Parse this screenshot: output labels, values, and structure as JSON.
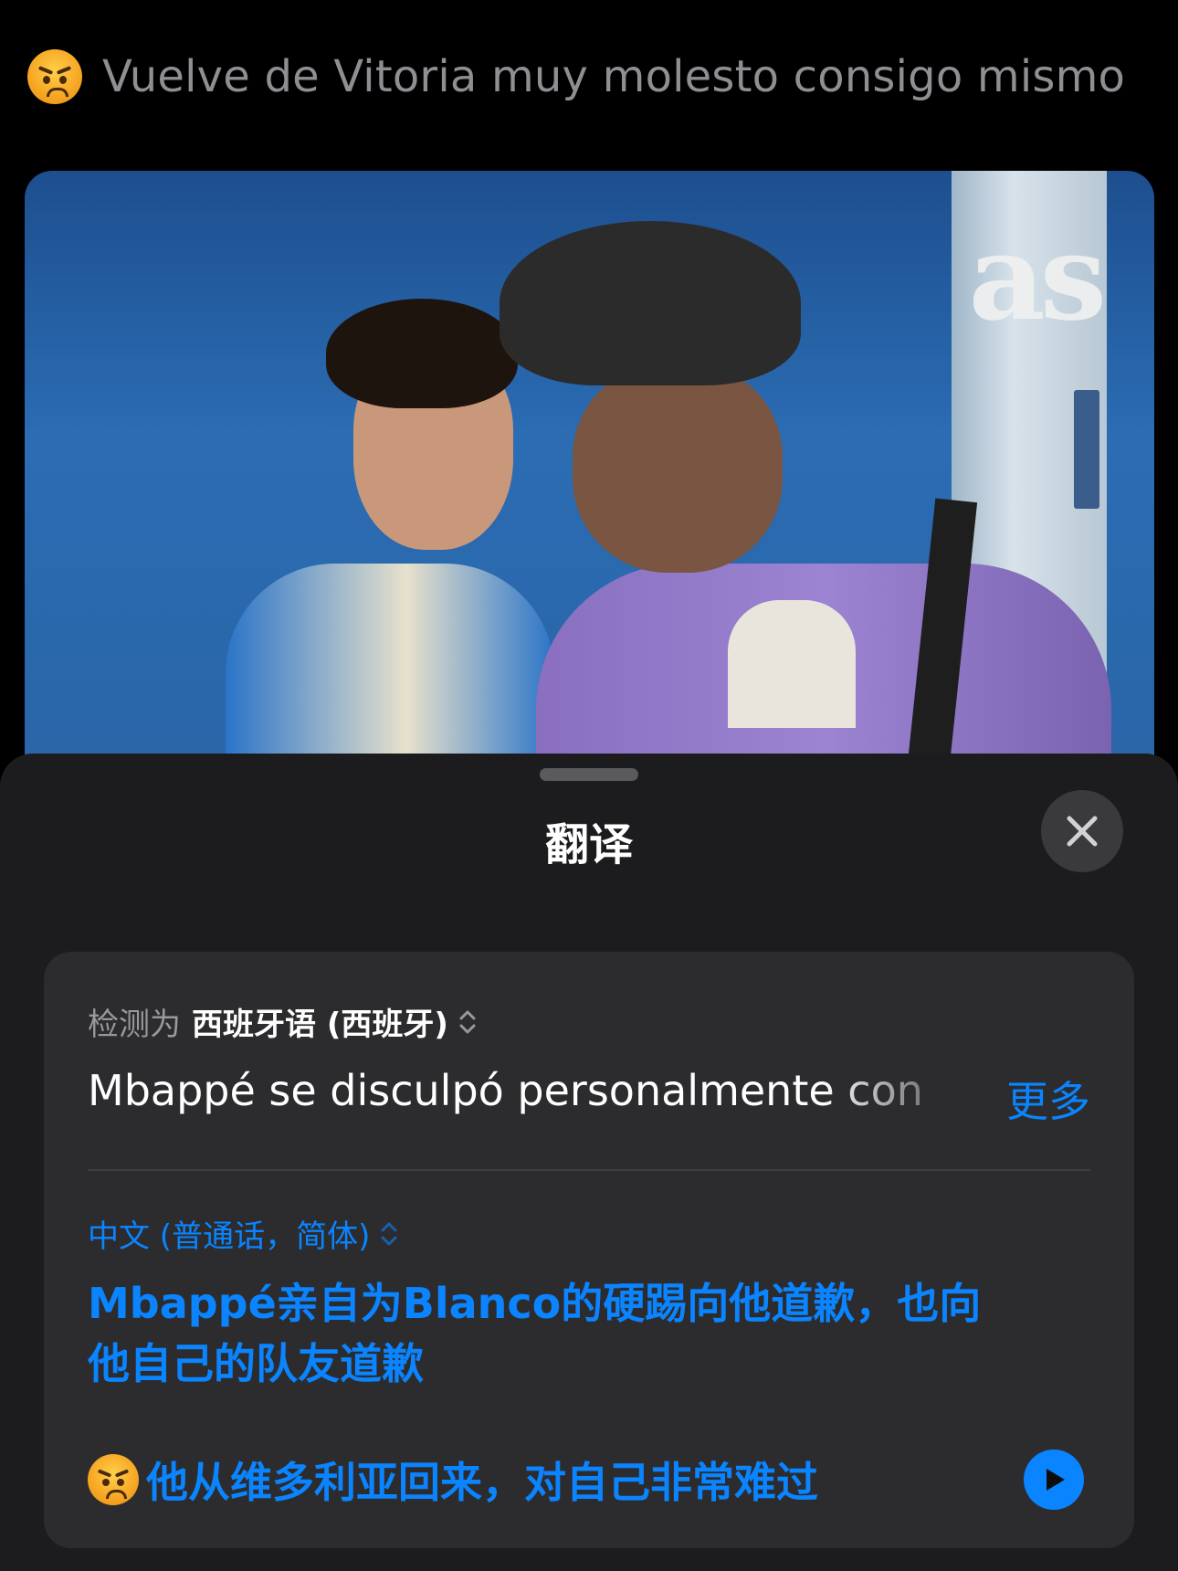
{
  "tweet": {
    "emoji_icon": "angry-face-icon",
    "text": "Vuelve de Vitoria muy molesto consigo mismo"
  },
  "photo": {
    "watermark": "as"
  },
  "sheet": {
    "title": "翻译",
    "close_icon": "close-icon",
    "source": {
      "detected_prefix": "检测为",
      "language": "西班牙语 (西班牙)",
      "text": "Mbappé se disculpó personalmente con",
      "more_label": "更多"
    },
    "target": {
      "language": "中文 (普通话，简体)",
      "text_line1": "Mbappé亲自为Blanco的硬踢向他道歉，也向他自己的队友道歉",
      "text_line2": "他从维多利亚回来，对自己非常难过"
    },
    "play_icon": "play-icon"
  },
  "colors": {
    "accent": "#0a84ff",
    "sheet_bg": "#1c1c1e",
    "card_bg": "#2c2c2e",
    "muted_text": "#8e8e93"
  }
}
